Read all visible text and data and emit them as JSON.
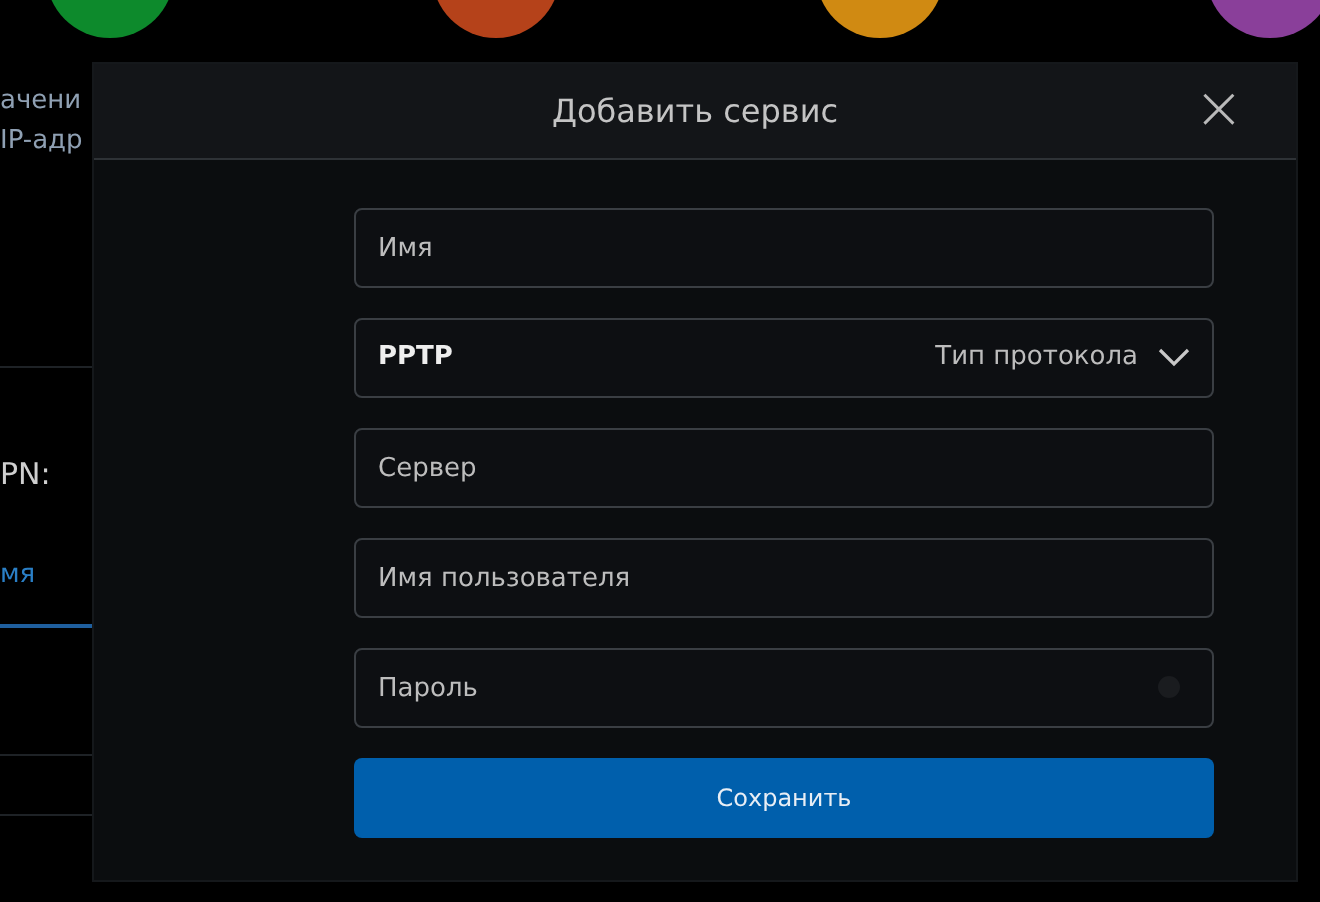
{
  "background": {
    "circles": [
      {
        "color": "#0d8a2c"
      },
      {
        "color": "#b5421a"
      },
      {
        "color": "#d08a12"
      },
      {
        "color": "#8a3f9a"
      }
    ],
    "info_lines": [
      "ачени",
      "IP-адр"
    ],
    "vpn_label": "PN:",
    "link": "мя"
  },
  "modal": {
    "title": "Добавить сервис",
    "close": "×",
    "fields": [
      {
        "kind": "text",
        "placeholder": "Имя"
      },
      {
        "kind": "select",
        "value": "PPTP",
        "label": "Тип протокола"
      },
      {
        "kind": "text",
        "placeholder": "Сервер"
      },
      {
        "kind": "text",
        "placeholder": "Имя пользователя"
      },
      {
        "kind": "password",
        "placeholder": "Пароль"
      }
    ],
    "button": "Сохранить"
  }
}
